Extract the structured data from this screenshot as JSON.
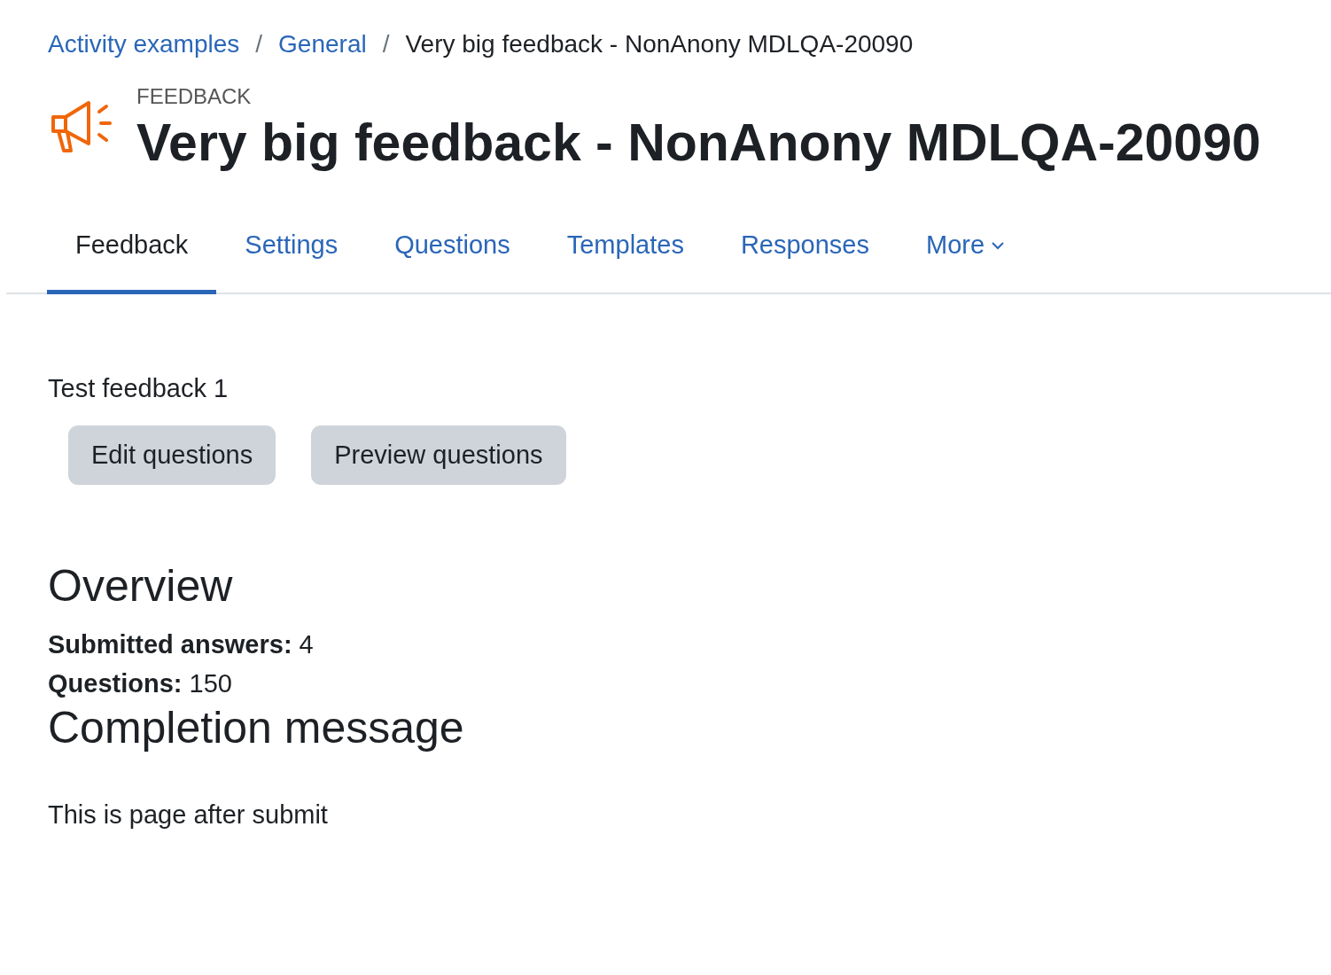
{
  "breadcrumb": [
    {
      "label": "Activity examples",
      "kind": "link"
    },
    {
      "label": "General",
      "kind": "link"
    },
    {
      "label": "Very big feedback - NonAnony MDLQA-20090",
      "kind": "current"
    }
  ],
  "breadcrumb_separator": "/",
  "header": {
    "module": "FEEDBACK",
    "title": "Very big feedback - NonAnony MDLQA-20090"
  },
  "tabs": [
    {
      "label": "Feedback",
      "selected": true,
      "kind": "tab"
    },
    {
      "label": "Settings",
      "selected": false,
      "kind": "tab"
    },
    {
      "label": "Questions",
      "selected": false,
      "kind": "tab"
    },
    {
      "label": "Templates",
      "selected": false,
      "kind": "tab"
    },
    {
      "label": "Responses",
      "selected": false,
      "kind": "tab"
    },
    {
      "label": "More",
      "selected": false,
      "kind": "dropdown"
    }
  ],
  "intro": "Test feedback 1",
  "buttons": [
    "Edit questions",
    "Preview questions"
  ],
  "overview": {
    "heading": "Overview",
    "stats": [
      "**Submitted answers:** 4",
      "**Questions:** 150"
    ]
  },
  "completion": {
    "heading": "Completion message",
    "text": "This is page after submit"
  }
}
